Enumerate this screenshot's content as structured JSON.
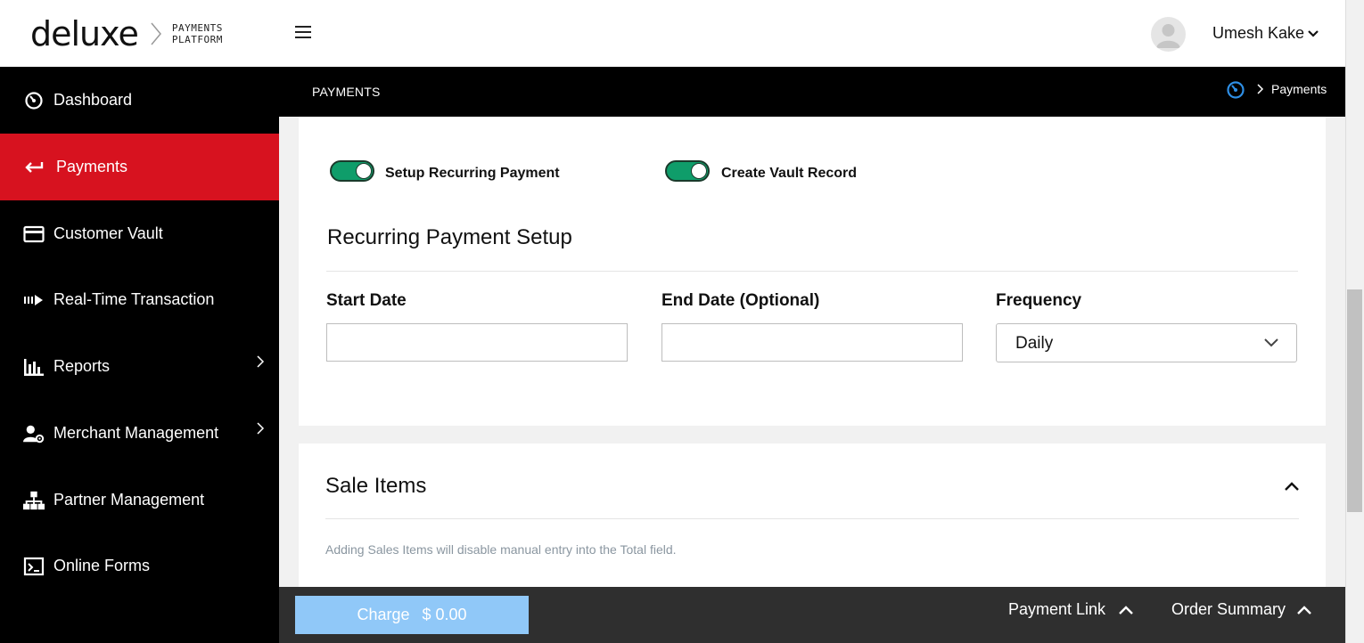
{
  "header": {
    "logo_text": "deluxe",
    "logo_sub_line1": "PAYMENTS",
    "logo_sub_line2": "PLATFORM",
    "user_name": "Umesh Kake",
    "menu_icon": "hamburger-icon",
    "avatar_icon": "user-avatar-icon"
  },
  "sidebar": {
    "items": [
      {
        "label": "Dashboard",
        "icon": "dashboard-gauge-icon",
        "active": false
      },
      {
        "label": "Payments",
        "icon": "return-arrow-icon",
        "active": true
      },
      {
        "label": "Customer Vault",
        "icon": "credit-card-icon",
        "active": false
      },
      {
        "label": "Real-Time Transaction",
        "icon": "fast-forward-icon",
        "active": false
      },
      {
        "label": "Reports",
        "icon": "bar-chart-icon",
        "active": false,
        "has_submenu": true
      },
      {
        "label": "Merchant Management",
        "icon": "user-gear-icon",
        "active": false,
        "has_submenu": true
      },
      {
        "label": "Partner Management",
        "icon": "org-chart-icon",
        "active": false
      },
      {
        "label": "Online Forms",
        "icon": "form-icon",
        "active": false
      }
    ]
  },
  "subheader": {
    "title": "PAYMENTS",
    "breadcrumb": "Payments"
  },
  "recurring": {
    "toggle_recurring_label": "Setup Recurring Payment",
    "toggle_recurring_on": true,
    "toggle_vault_label": "Create Vault Record",
    "toggle_vault_on": true,
    "section_title": "Recurring Payment Setup",
    "start_date_label": "Start Date",
    "start_date_value": "",
    "end_date_label": "End Date (Optional)",
    "end_date_value": "",
    "frequency_label": "Frequency",
    "frequency_value": "Daily"
  },
  "sale_items": {
    "title": "Sale Items",
    "hint": "Adding Sales Items will disable manual entry into the Total field."
  },
  "footer": {
    "charge_label": "Charge",
    "charge_amount": "$ 0.00",
    "payment_link_label": "Payment Link",
    "order_summary_label": "Order Summary"
  },
  "colors": {
    "active_nav": "#d7121f",
    "toggle_on": "#0f9d6a",
    "charge_button": "#90c8f8",
    "footer_bg": "#2f2f2f"
  }
}
